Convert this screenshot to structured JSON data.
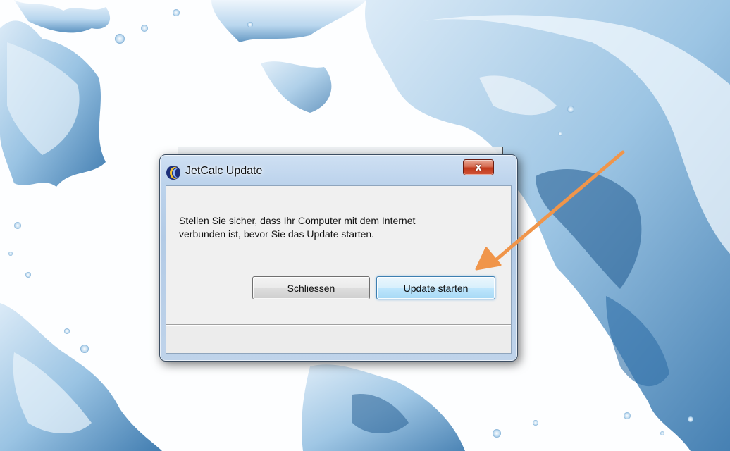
{
  "dialog": {
    "title": "JetCalc Update",
    "close_glyph": "x",
    "message_line1": "Stellen Sie sicher, dass Ihr Computer mit dem Internet",
    "message_line2": "verbunden ist, bevor Sie das Update starten.",
    "buttons": {
      "close_label": "Schliessen",
      "update_label": "Update starten"
    }
  },
  "icons": {
    "app_icon": "jetcalc-logo-icon",
    "close_icon": "close-icon"
  },
  "annotation": {
    "type": "arrow",
    "points_to": "update-start-button",
    "color": "#f0954a"
  },
  "wallpaper": {
    "description_colors": [
      "#1f5f97",
      "#7fb0d8",
      "#dbeaf5",
      "#ffffff"
    ]
  }
}
